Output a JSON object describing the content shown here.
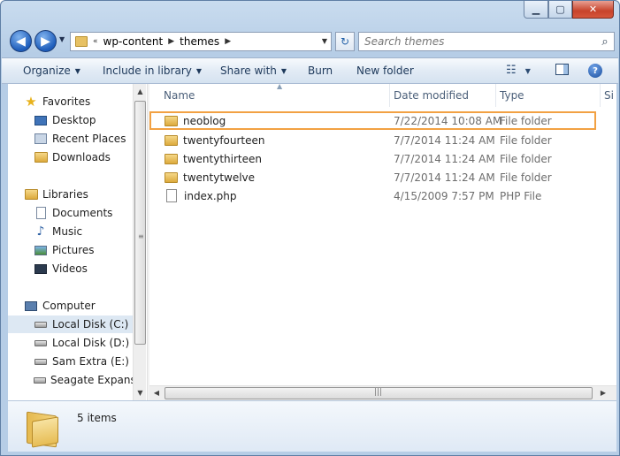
{
  "window": {
    "caption": {
      "minimize": "▁",
      "maximize": "▢",
      "close": "✕"
    }
  },
  "navigation": {
    "back_icon": "◀",
    "forward_icon": "▶",
    "address": {
      "overflow": "«",
      "crumbs": [
        "wp-content",
        "themes"
      ]
    },
    "refresh_icon": "↻",
    "search": {
      "placeholder": "Search themes",
      "value": ""
    }
  },
  "toolbar": {
    "organize": "Organize",
    "include_in_library": "Include in library",
    "share_with": "Share with",
    "burn": "Burn",
    "new_folder": "New folder",
    "help": "?"
  },
  "sidebar": {
    "favorites": {
      "label": "Favorites",
      "items": [
        "Desktop",
        "Recent Places",
        "Downloads"
      ]
    },
    "libraries": {
      "label": "Libraries",
      "items": [
        "Documents",
        "Music",
        "Pictures",
        "Videos"
      ]
    },
    "computer": {
      "label": "Computer",
      "items": [
        "Local Disk (C:)",
        "Local Disk (D:)",
        "Sam Extra (E:)",
        "Seagate Expansio"
      ],
      "selected": "Local Disk (C:)"
    }
  },
  "file_list": {
    "columns": {
      "name": "Name",
      "date_modified": "Date modified",
      "type": "Type",
      "size": "Si"
    },
    "rows": [
      {
        "name": "neoblog",
        "date": "7/22/2014 10:08 AM",
        "type": "File folder",
        "icon": "folder-icon",
        "highlighted": true
      },
      {
        "name": "twentyfourteen",
        "date": "7/7/2014 11:24 AM",
        "type": "File folder",
        "icon": "folder-icon"
      },
      {
        "name": "twentythirteen",
        "date": "7/7/2014 11:24 AM",
        "type": "File folder",
        "icon": "folder-icon"
      },
      {
        "name": "twentytwelve",
        "date": "7/7/2014 11:24 AM",
        "type": "File folder",
        "icon": "folder-icon"
      },
      {
        "name": "index.php",
        "date": "4/15/2009 7:57 PM",
        "type": "PHP File",
        "icon": "file-icon"
      }
    ]
  },
  "details": {
    "items_count": "5 items"
  },
  "colors": {
    "highlight_border": "#f2a143",
    "selected_bg": "#dde8f3",
    "accent": "#1e395b"
  }
}
